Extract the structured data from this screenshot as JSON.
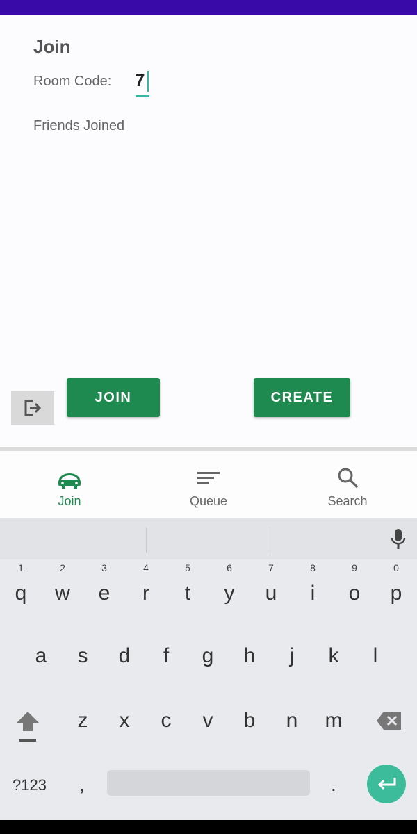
{
  "screen": {
    "title": "Join",
    "room_code_label": "Room Code:",
    "room_code_value": "7",
    "friends_label": "Friends Joined",
    "join_button": "JOIN",
    "create_button": "CREATE",
    "logout_icon": "logout-icon"
  },
  "nav": {
    "items": [
      {
        "label": "Join",
        "icon": "car-icon",
        "active": true
      },
      {
        "label": "Queue",
        "icon": "queue-icon",
        "active": false
      },
      {
        "label": "Search",
        "icon": "search-icon",
        "active": false
      }
    ]
  },
  "keyboard": {
    "row1": [
      "q",
      "w",
      "e",
      "r",
      "t",
      "y",
      "u",
      "i",
      "o",
      "p"
    ],
    "row1_hints": [
      "1",
      "2",
      "3",
      "4",
      "5",
      "6",
      "7",
      "8",
      "9",
      "0"
    ],
    "row2": [
      "a",
      "s",
      "d",
      "f",
      "g",
      "h",
      "j",
      "k",
      "l"
    ],
    "row3": [
      "z",
      "x",
      "c",
      "v",
      "b",
      "n",
      "m"
    ],
    "symbols_key": "?123",
    "comma_key": ",",
    "period_key": "."
  },
  "colors": {
    "accent": "#1f8a4f",
    "status_bar": "#3a0aa8",
    "enter_key": "#3dbc9c"
  }
}
